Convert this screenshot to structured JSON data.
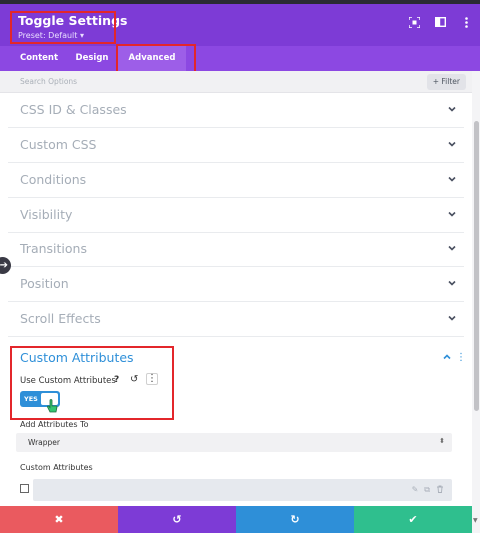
{
  "header": {
    "title": "Toggle Settings",
    "preset": "Preset: Default ▾",
    "icons": [
      "expand-icon",
      "split-view-icon",
      "more-icon"
    ]
  },
  "tabs": [
    {
      "label": "Content",
      "active": false
    },
    {
      "label": "Design",
      "active": false
    },
    {
      "label": "Advanced",
      "active": true
    }
  ],
  "search": {
    "placeholder": "Search Options",
    "filter_label": "+ Filter"
  },
  "sections": [
    "CSS ID & Classes",
    "Custom CSS",
    "Conditions",
    "Visibility",
    "Transitions",
    "Position",
    "Scroll Effects"
  ],
  "custom_attributes": {
    "title": "Custom Attributes",
    "use_label": "Use Custom Attributes",
    "help_glyph": "?",
    "toggle_value": "YES",
    "add_to_label": "Add Attributes To",
    "add_to_value": "Wrapper",
    "list_label": "Custom Attributes"
  },
  "footer": {
    "buttons": [
      {
        "name": "discard",
        "glyph": "✖",
        "color": "#ea5a5f"
      },
      {
        "name": "undo",
        "glyph": "↺",
        "color": "#7d3bd6"
      },
      {
        "name": "redo",
        "glyph": "↻",
        "color": "#2e8fd8"
      },
      {
        "name": "save",
        "glyph": "✔",
        "color": "#2fbf8e"
      }
    ]
  },
  "colors": {
    "header": "#7d3bd6",
    "tabs": "#8c48e2",
    "accent_blue": "#2e8fd8",
    "highlight_box": "#e3262b"
  }
}
